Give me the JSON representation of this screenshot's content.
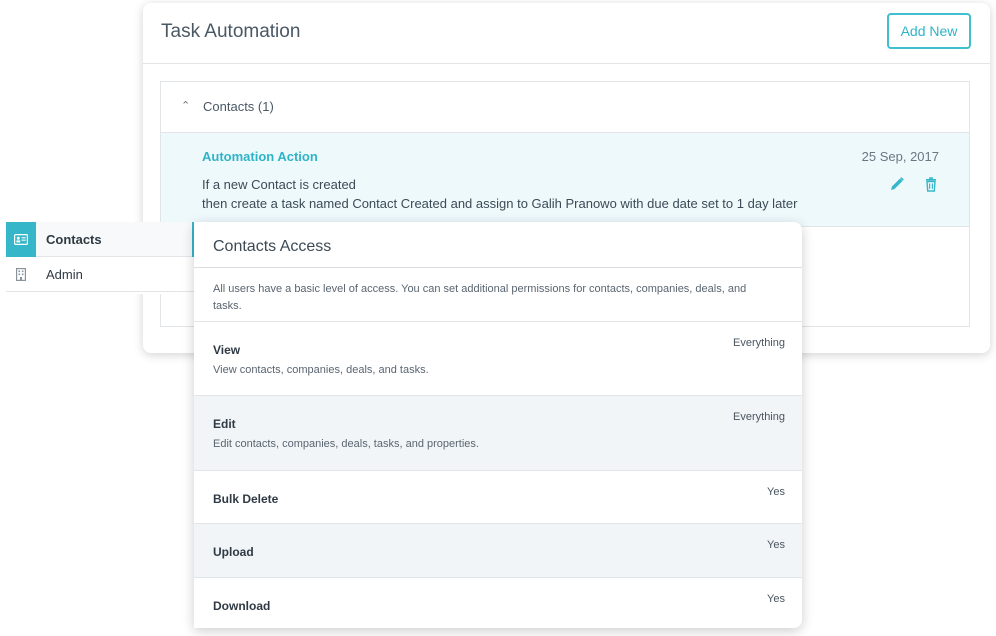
{
  "task_automation": {
    "title": "Task Automation",
    "add_button": "Add New",
    "group_label": "Contacts (1)",
    "automation": {
      "title": "Automation Action",
      "date": "25 Sep, 2017",
      "line1": "If a new Contact is created",
      "line2": "then create a task named Contact Created and assign to Galih Pranowo with due date set to 1 day later"
    }
  },
  "sidebar": {
    "items": [
      {
        "label": "Contacts",
        "icon": "contact-card-icon",
        "active": true
      },
      {
        "label": "Admin",
        "icon": "building-icon",
        "active": false
      }
    ]
  },
  "contacts_access": {
    "title": "Contacts Access",
    "description": "All users have a basic level of access. You can set additional permissions for contacts, companies, deals, and tasks.",
    "permissions": [
      {
        "name": "View",
        "description": "View contacts, companies, deals, and tasks.",
        "value": "Everything"
      },
      {
        "name": "Edit",
        "description": "Edit contacts, companies, deals, tasks, and properties.",
        "value": "Everything"
      },
      {
        "name": "Bulk Delete",
        "description": "",
        "value": "Yes"
      },
      {
        "name": "Upload",
        "description": "",
        "value": "Yes"
      },
      {
        "name": "Download",
        "description": "",
        "value": "Yes"
      }
    ]
  },
  "colors": {
    "accent": "#36b7c9",
    "highlight_row": "#eef9fc",
    "shaded_row": "#f2f5f8"
  }
}
